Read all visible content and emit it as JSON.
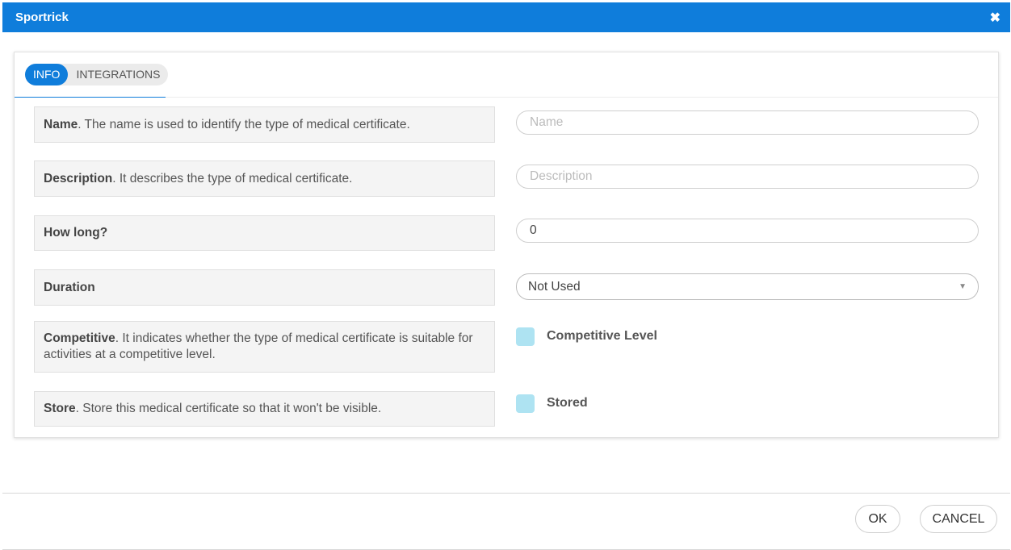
{
  "window": {
    "title": "Sportrick",
    "close_glyph": "✖"
  },
  "tabs": [
    {
      "label": "INFO",
      "active": true
    },
    {
      "label": "INTEGRATIONS",
      "active": false
    }
  ],
  "fields": {
    "name": {
      "label_bold": "Name",
      "label_rest": ". The name is used to identify the type of medical certificate.",
      "placeholder": "Name",
      "value": ""
    },
    "description": {
      "label_bold": "Description",
      "label_rest": ". It describes the type of medical certificate.",
      "placeholder": "Description",
      "value": ""
    },
    "how_long": {
      "label_bold": "How long?",
      "value": "0"
    },
    "duration": {
      "label_bold": "Duration",
      "selected": "Not Used"
    },
    "competitive": {
      "label_bold": "Competitive",
      "label_rest": ". It indicates whether the type of medical certificate is suitable for activities at a competitive level.",
      "checkbox_label": "Competitive Level",
      "checked": false
    },
    "store": {
      "label_bold": "Store",
      "label_rest": ". Store this medical certificate so that it won't be visible.",
      "checkbox_label": "Stored",
      "checked": false
    }
  },
  "footer": {
    "ok_label": "OK",
    "cancel_label": "CANCEL"
  },
  "colors": {
    "accent": "#0f7ddb",
    "checkbox": "#aee3f2"
  }
}
